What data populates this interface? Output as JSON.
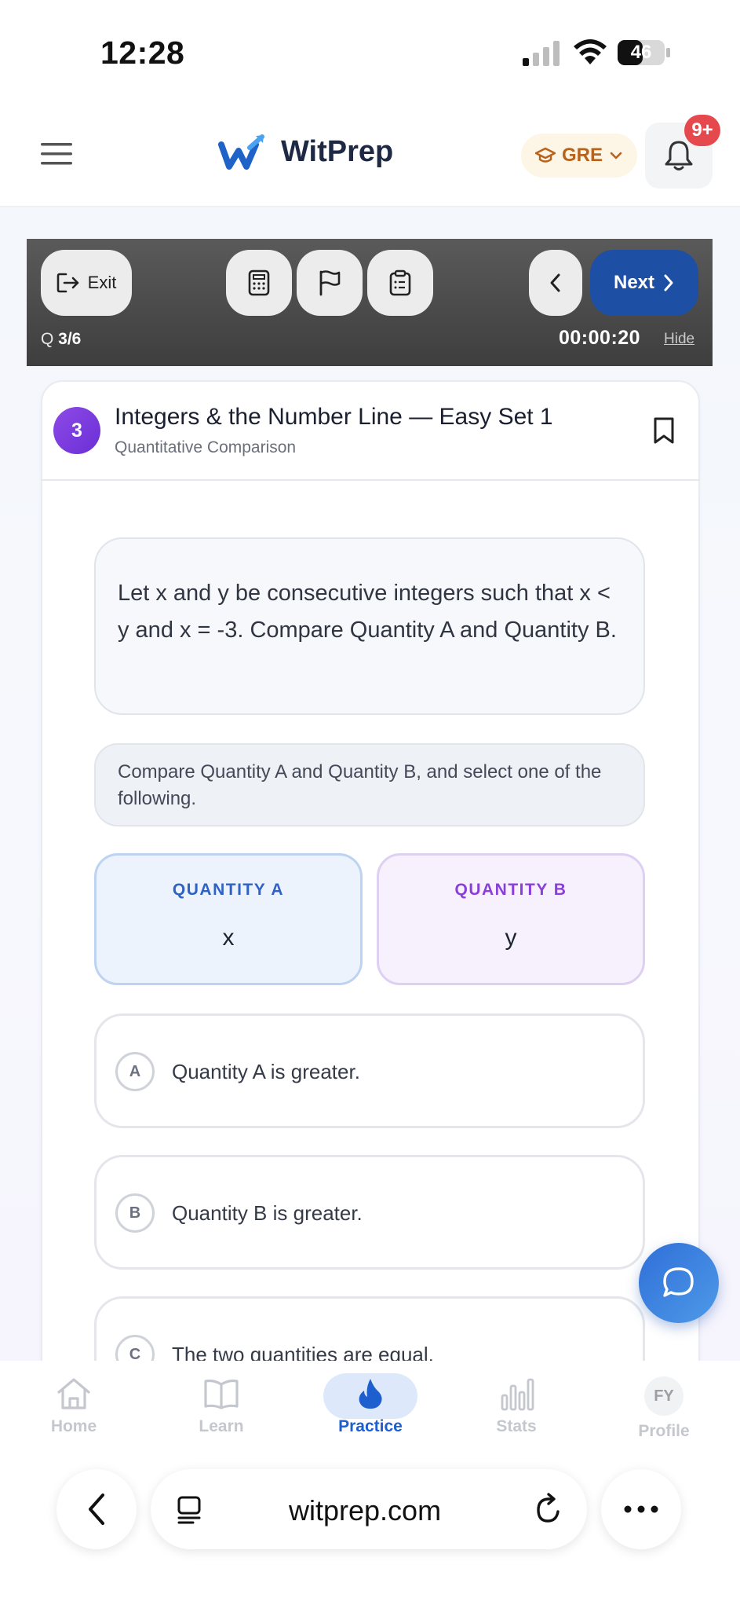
{
  "status_bar": {
    "time": "12:28",
    "battery": "46"
  },
  "header": {
    "brand": "WitPrep",
    "exam": "GRE",
    "notification_badge": "9+"
  },
  "toolbar": {
    "exit_label": "Exit",
    "next_label": "Next",
    "question_prefix": "Q ",
    "question_counter": "3/6",
    "timer": "00:00:20",
    "hide_label": "Hide"
  },
  "question": {
    "number": "3",
    "set_title": "Integers & the Number Line — Easy Set 1",
    "type": "Quantitative Comparison",
    "stem": "Let x and y be consecutive integers such that x < y and x = -3. Compare Quantity A and Quantity B.",
    "instruction": "Compare Quantity A and Quantity B, and select one of the following.",
    "quantity_a": {
      "label": "QUANTITY A",
      "value": "x"
    },
    "quantity_b": {
      "label": "QUANTITY B",
      "value": "y"
    },
    "options": [
      {
        "letter": "A",
        "text": "Quantity A is greater."
      },
      {
        "letter": "B",
        "text": "Quantity B is greater."
      },
      {
        "letter": "C",
        "text": "The two quantities are equal."
      }
    ]
  },
  "bottom_nav": {
    "items": [
      {
        "label": "Home",
        "icon": "home-icon"
      },
      {
        "label": "Learn",
        "icon": "book-icon"
      },
      {
        "label": "Practice",
        "icon": "flame-icon",
        "active": true
      },
      {
        "label": "Stats",
        "icon": "bar-chart-icon"
      },
      {
        "label": "Profile",
        "icon": "avatar",
        "initials": "FY"
      }
    ]
  },
  "browser": {
    "url": "witprep.com"
  },
  "colors": {
    "primary": "#1d4fa5",
    "accent_purple": "#7a3be0",
    "quantity_a": "#2e62c4",
    "quantity_b": "#8a3fd8",
    "exam_pill_text": "#b8621b",
    "badge": "#e5484d",
    "active_nav": "#1e5fd0"
  }
}
